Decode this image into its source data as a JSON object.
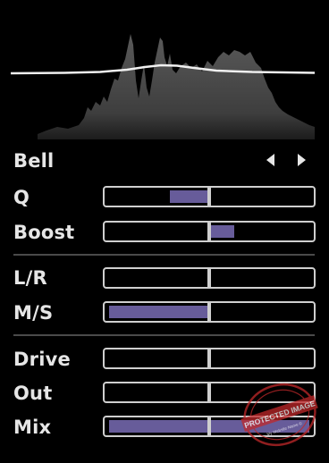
{
  "filter": {
    "type_label": "Bell"
  },
  "nav": {
    "prev_icon": "triangle-left-icon",
    "next_icon": "triangle-right-icon"
  },
  "controls": [
    {
      "id": "q",
      "label": "Q",
      "fill_from": 0.31,
      "fill_to": 0.5
    },
    {
      "id": "boost",
      "label": "Boost",
      "fill_from": 0.5,
      "fill_to": 0.62
    },
    {
      "id": "lr",
      "label": "L/R",
      "fill_from": 0.5,
      "fill_to": 0.5
    },
    {
      "id": "ms",
      "label": "M/S",
      "fill_from": 0.02,
      "fill_to": 0.5
    },
    {
      "id": "drive",
      "label": "Drive",
      "fill_from": 0.5,
      "fill_to": 0.5
    },
    {
      "id": "out",
      "label": "Out",
      "fill_from": 0.5,
      "fill_to": 0.5
    },
    {
      "id": "mix",
      "label": "Mix",
      "fill_from": 0.02,
      "fill_to": 0.98
    }
  ],
  "watermark": {
    "text": "PROTECTED IMAGE",
    "subtext": "My Website Name ©"
  },
  "colors": {
    "background": "#000000",
    "slider_border": "#cfcfcf",
    "slider_fill": "#675c9a",
    "label_text": "#e6e6e6",
    "spectrum_fill": "#4d4d4d",
    "eq_curve": "#f0f0f0",
    "separator": "#4a4a4a",
    "watermark_red": "#c0282a"
  }
}
